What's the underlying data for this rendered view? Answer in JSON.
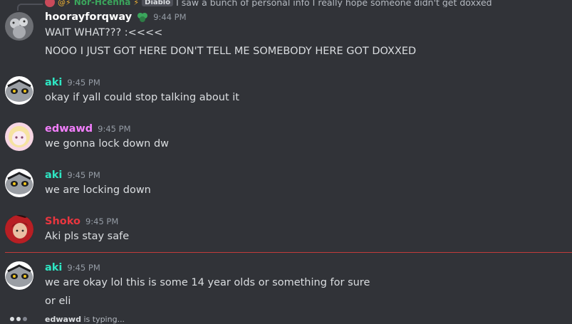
{
  "reply": {
    "name": "Nor-Hcenna",
    "tag": "Diablo",
    "text": "I saw a bunch of personal info I really hope someone didn't get doxxed"
  },
  "messages": [
    {
      "user": "hoorayforqway",
      "color": "#ffffff",
      "time": "9:44 PM",
      "lines": [
        "WAIT WHAT??? :<<<<",
        "NOOO I JUST GOT HERE DON'T TELL ME SOMEBODY HERE GOT DOXXED"
      ]
    },
    {
      "user": "aki",
      "color": "#2ee6c3",
      "time": "9:45 PM",
      "lines": [
        "okay if yall could stop talking about it"
      ]
    },
    {
      "user": "edwawd",
      "color": "#f47fff",
      "time": "9:45 PM",
      "lines": [
        "we gonna lock down dw"
      ]
    },
    {
      "user": "aki",
      "color": "#2ee6c3",
      "time": "9:45 PM",
      "lines": [
        "we are locking down"
      ]
    },
    {
      "user": "Shoko",
      "color": "#e8363f",
      "time": "9:45 PM",
      "lines": [
        "Aki pls stay safe"
      ]
    },
    {
      "user": "aki",
      "color": "#2ee6c3",
      "time": "9:45 PM",
      "lines": [
        "we are okay lol this is some 14 year olds or something for sure",
        "or eli"
      ]
    }
  ],
  "typing": {
    "user": "edwawd",
    "suffix": "is typing..."
  }
}
